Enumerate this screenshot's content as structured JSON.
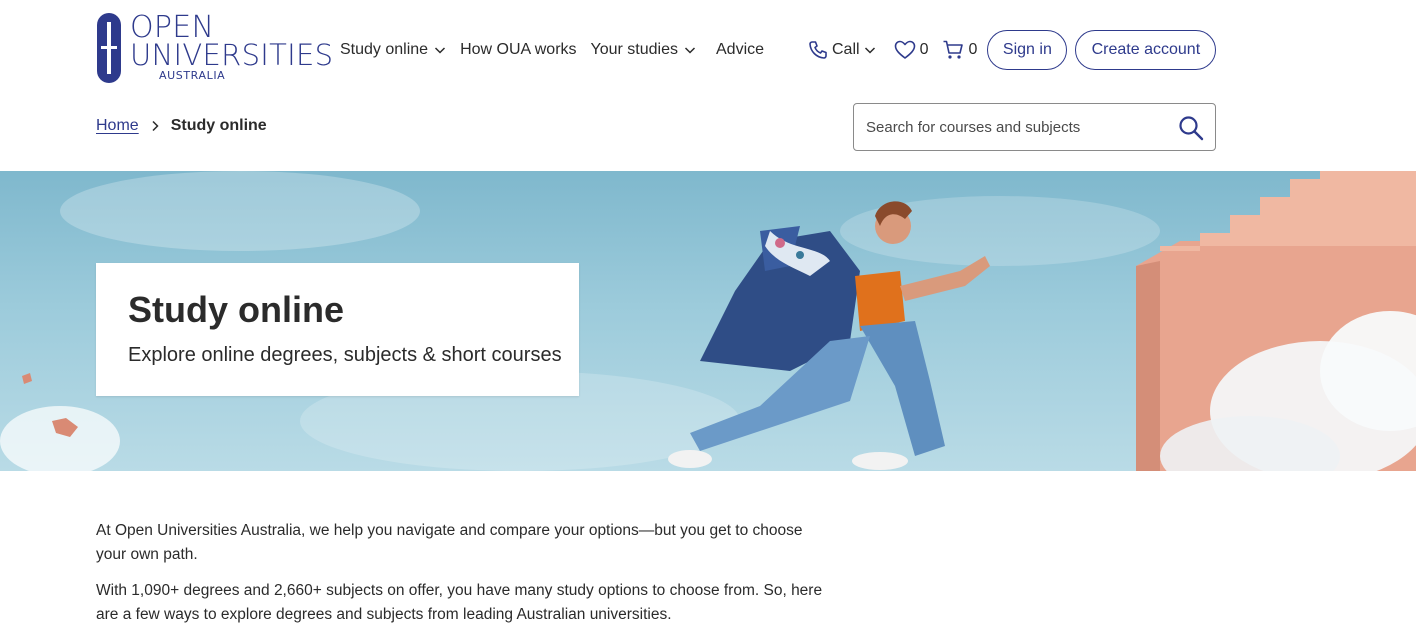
{
  "logo": {
    "line1": "OPEN",
    "line2": "UNIVERSITIES",
    "line3": "AUSTRALIA"
  },
  "nav": {
    "items": [
      {
        "label": "Study online",
        "dropdown": true
      },
      {
        "label": "How OUA works",
        "dropdown": false
      },
      {
        "label": "Your studies",
        "dropdown": true
      },
      {
        "label": "Advice",
        "dropdown": false
      }
    ]
  },
  "utility": {
    "call_label": "Call",
    "wishlist_count": "0",
    "cart_count": "0",
    "signin_label": "Sign in",
    "create_label": "Create account"
  },
  "breadcrumb": {
    "home": "Home",
    "current": "Study online"
  },
  "search": {
    "placeholder": "Search for courses and subjects"
  },
  "hero": {
    "title": "Study online",
    "subtitle": "Explore online degrees, subjects & short courses"
  },
  "content": {
    "paragraphs": [
      "At Open Universities Australia, we help you navigate and compare your options—but you get to choose your own path.",
      "With 1,090+ degrees and 2,660+ subjects on offer, you have many study options to choose from. So, here are a few ways to explore degrees and subjects from leading Australian universities."
    ]
  },
  "colors": {
    "brand": "#2e3a8c",
    "text": "#2b2b2b",
    "sky": "#9ccbdb",
    "wall": "#e8a58f"
  }
}
